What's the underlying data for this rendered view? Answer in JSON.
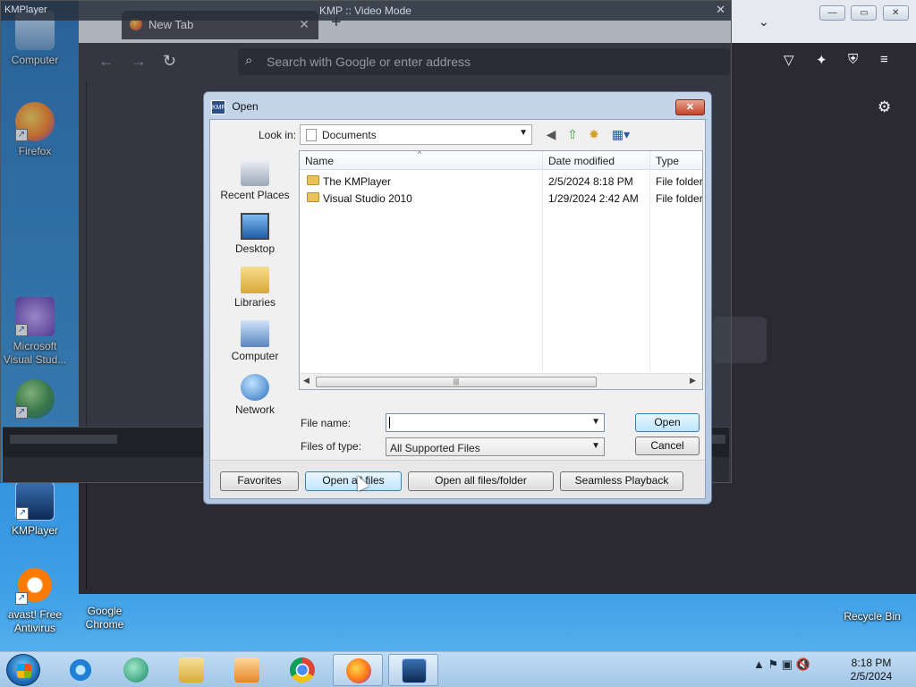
{
  "desktop": {
    "icons": [
      {
        "label": "Computer"
      },
      {
        "label": "Firefox"
      },
      {
        "label": "Microsoft Visual Stud..."
      },
      {
        "label": "KMPlayer"
      },
      {
        "label": "avast! Free Antivirus"
      },
      {
        "label": "Google Chrome"
      },
      {
        "label": "Recycle Bin"
      }
    ]
  },
  "browser": {
    "tab_title": "New Tab",
    "tab_close": "✕",
    "new_tab": "+",
    "tab_list": "⌄",
    "back": "←",
    "forward": "→",
    "reload": "↻",
    "url_placeholder": "Search with Google or enter address",
    "search_glyph": "⌕",
    "gear_glyph": "⚙"
  },
  "kmplayer": {
    "title": "KMP :: Video Mode",
    "logo": "KMPlayer",
    "close": "✕"
  },
  "window_buttons": {
    "min": "—",
    "max": "▭",
    "close": "✕"
  },
  "dialog": {
    "title": "Open",
    "icon_text": "KMP",
    "close": "✕",
    "look_in_label": "Look in:",
    "look_in_value": "Documents",
    "places": [
      {
        "label": "Recent Places"
      },
      {
        "label": "Desktop"
      },
      {
        "label": "Libraries"
      },
      {
        "label": "Computer"
      },
      {
        "label": "Network"
      }
    ],
    "columns": {
      "name": "Name",
      "date": "Date modified",
      "type": "Type"
    },
    "files": [
      {
        "name": "The KMPlayer",
        "date": "2/5/2024 8:18 PM",
        "type": "File folder"
      },
      {
        "name": "Visual Studio 2010",
        "date": "1/29/2024 2:42 AM",
        "type": "File folder"
      }
    ],
    "file_name_label": "File name:",
    "file_name_value": "",
    "files_of_type_label": "Files of type:",
    "files_of_type_value": "All Supported Files",
    "open_button": "Open",
    "cancel_button": "Cancel",
    "bottom_buttons": {
      "favorites": "Favorites",
      "open_files": "Open all files",
      "open_folder": "Open all files/folder",
      "seamless": "Seamless Playback"
    }
  },
  "taskbar": {
    "clock_time": "8:18 PM",
    "clock_date": "2/5/2024",
    "tray_glyphs": "▲  ⚑  ▣  🔇"
  }
}
